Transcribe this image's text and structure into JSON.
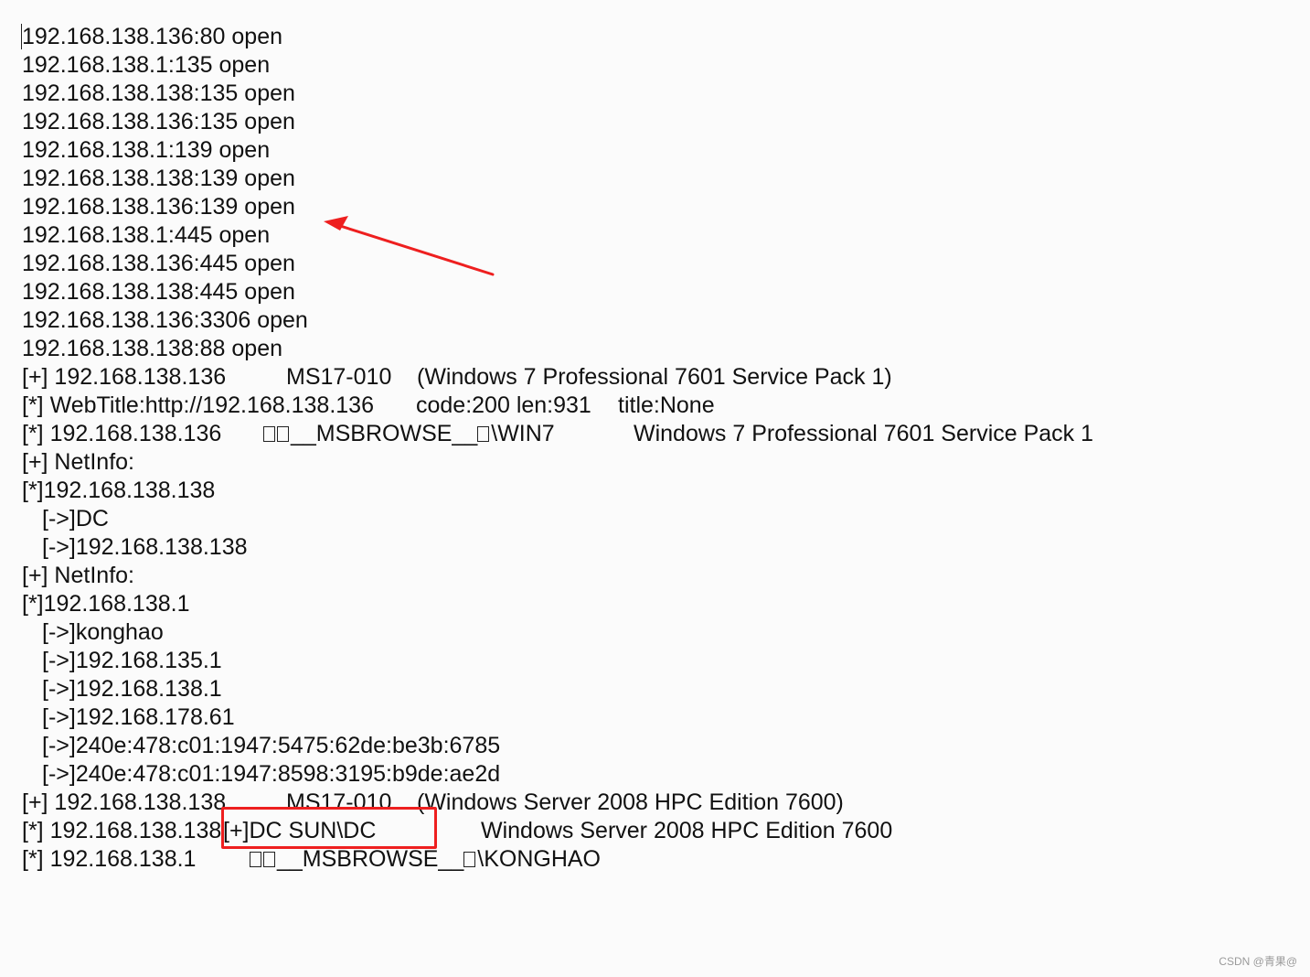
{
  "scan_output": {
    "lines": [
      "192.168.138.136:80 open",
      "192.168.138.1:135 open",
      "192.168.138.138:135 open",
      "192.168.138.136:135 open",
      "192.168.138.1:139 open",
      "192.168.138.138:139 open",
      "192.168.138.136:139 open",
      "192.168.138.1:445 open",
      "192.168.138.136:445 open",
      "192.168.138.138:445 open",
      "192.168.138.136:3306 open",
      "192.168.138.138:88 open"
    ],
    "ms17_win7": {
      "prefix": "[+] 192.168.138.136",
      "vuln": "MS17-010",
      "os": "(Windows 7 Professional 7601 Service Pack 1)"
    },
    "webtitle": {
      "prefix": "[*] WebTitle:http://192.168.138.136",
      "code": "code:200 len:931",
      "title": "title:None"
    },
    "netbios_win7": {
      "prefix": "[*] 192.168.138.136",
      "name_a": "__MSBROWSE__",
      "name_b": "\\WIN7",
      "os": "Windows 7 Professional 7601 Service Pack 1"
    },
    "netinfo_138": {
      "header": "[+] NetInfo:",
      "host": "[*]192.168.138.138",
      "items": [
        "[->]DC",
        "[->]192.168.138.138"
      ]
    },
    "netinfo_1": {
      "header": "[+] NetInfo:",
      "host": "[*]192.168.138.1",
      "items": [
        "[->]konghao",
        "[->]192.168.135.1",
        "[->]192.168.138.1",
        "[->]192.168.178.61",
        "[->]240e:478:c01:1947:5475:62de:be3b:6785",
        "[->]240e:478:c01:1947:8598:3195:b9de:ae2d"
      ]
    },
    "ms17_dc": {
      "prefix": "[+] 192.168.138.138",
      "vuln": "MS17-010",
      "os": "(Windows Server 2008 HPC Edition 7600)"
    },
    "netbios_dc": {
      "prefix": "[*] 192.168.138.138",
      "name": "[+]DC SUN\\DC",
      "os": "Windows Server 2008 HPC Edition 7600"
    },
    "netbios_konghao": {
      "prefix": "[*] 192.168.138.1",
      "name_a": "__MSBROWSE__",
      "name_b": "\\KONGHAO"
    }
  },
  "annotations": {
    "arrow_color": "#ee1f1f",
    "box_color": "#ee1f1f"
  },
  "watermark": "CSDN @青果@"
}
